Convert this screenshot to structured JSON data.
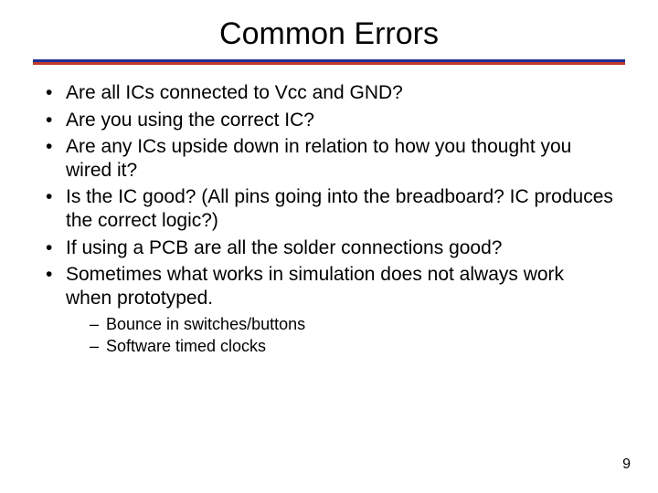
{
  "title": "Common Errors",
  "bullets": {
    "b0": "Are all ICs connected to Vcc and GND?",
    "b1": "Are you using the correct IC?",
    "b2": "Are any ICs upside down in relation to how you thought you wired it?",
    "b3": "Is the IC good? (All pins going into the breadboard? IC produces the correct logic?)",
    "b4": "If using a PCB are all the solder connections good?",
    "b5": "Sometimes what works in simulation does not always work when prototyped."
  },
  "subbullets": {
    "s0": "Bounce in switches/buttons",
    "s1": "Software timed clocks"
  },
  "page_number": "9"
}
